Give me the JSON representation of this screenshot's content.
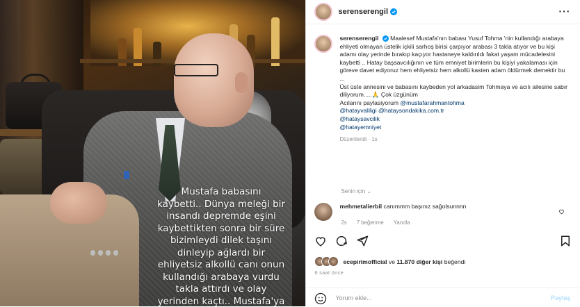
{
  "header": {
    "username": "serenserengil",
    "more_icon": "more-horizontal-icon"
  },
  "photo": {
    "caption": "Mustafa babasını\nkaybetti.. Dünya meleği bir\ninsandı depremde eşini\nkaybettikten sonra bir süre\nbizimleydi dilek taşını\ndinleyip ağlardı bir\nehliyetsiz alkollü canı onun\nkullandığı arabaya vurdu\ntakla attırdı ve olay\nyerinden kaçtı.. Mustafa'ya"
  },
  "post": {
    "username": "serenserengil",
    "text": "Maalesef Mustafa'nın babası Yusuf Tohma 'nin kullandığı arabaya ehliyeti olmayan üstelik içkili sarhoş birisi çarpıyor arabası 3 takla atıyor ve bu kişi adamı olay yerinde bırakıp kaçıyor hastaneye kaldırıldı fakat yaşam mücadelesini kaybetti .. Hatay başsavcılığının ve tüm emniyet birimlerin bu kişiyi yakalaması için göreve davet ediyoruz hem ehliyetsiz hem alkollü kasten adam öldürmek demektir bu ...\nÜst üste annesini ve babasını kaybeden yol arkadasim Tohmaya ve acılı ailesine sabır diliyorum.....🙏 Çok üzgünüm\nAcılarını paylasiyorum ",
    "mentions": [
      "@mustafarahmantohma",
      "@hatayvaliligi",
      "@hataysondakika.com.tr",
      "@hataysavcilik",
      "@hatayemniyet"
    ],
    "edited": "Düzenlendi · 1s",
    "translate": "Senin için ⌄"
  },
  "comment": {
    "username": "mehmetalierbil",
    "text": "canımmm başınız sağolsunnnn",
    "time": "2s",
    "likes": "7 beğenme",
    "reply": "Yanıtla"
  },
  "likes": {
    "first_user": "ecepirimofficial",
    "connector": "ve",
    "others": "11.870 diğer kişi",
    "suffix": "beğendi"
  },
  "timestamp": "6 saat önce",
  "add_comment": {
    "placeholder": "Yorum ekle...",
    "send_label": "Paylaş"
  },
  "colors": {
    "verified": "#0095f6",
    "mention": "#00376b",
    "muted": "#8e8e8e"
  }
}
